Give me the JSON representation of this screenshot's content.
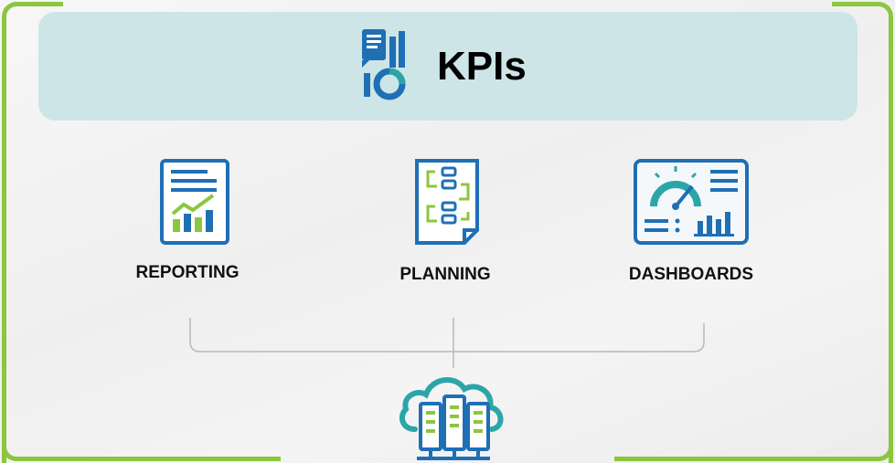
{
  "header": {
    "title": "KPIs",
    "icon": "report-chart-icon"
  },
  "items": [
    {
      "label": "REPORTING",
      "icon": "report-chart-icon"
    },
    {
      "label": "PLANNING",
      "icon": "workflow-checklist-icon"
    },
    {
      "label": "DASHBOARDS",
      "icon": "gauge-dashboard-icon"
    }
  ],
  "footer": {
    "icon": "cloud-server-icon"
  },
  "colors": {
    "frame": "#8cc63f",
    "banner": "#cde5e6",
    "icon_blue": "#1f6fb5",
    "icon_teal": "#2aa6a8",
    "icon_green": "#8cc63f",
    "connector": "#b8b8b8"
  }
}
